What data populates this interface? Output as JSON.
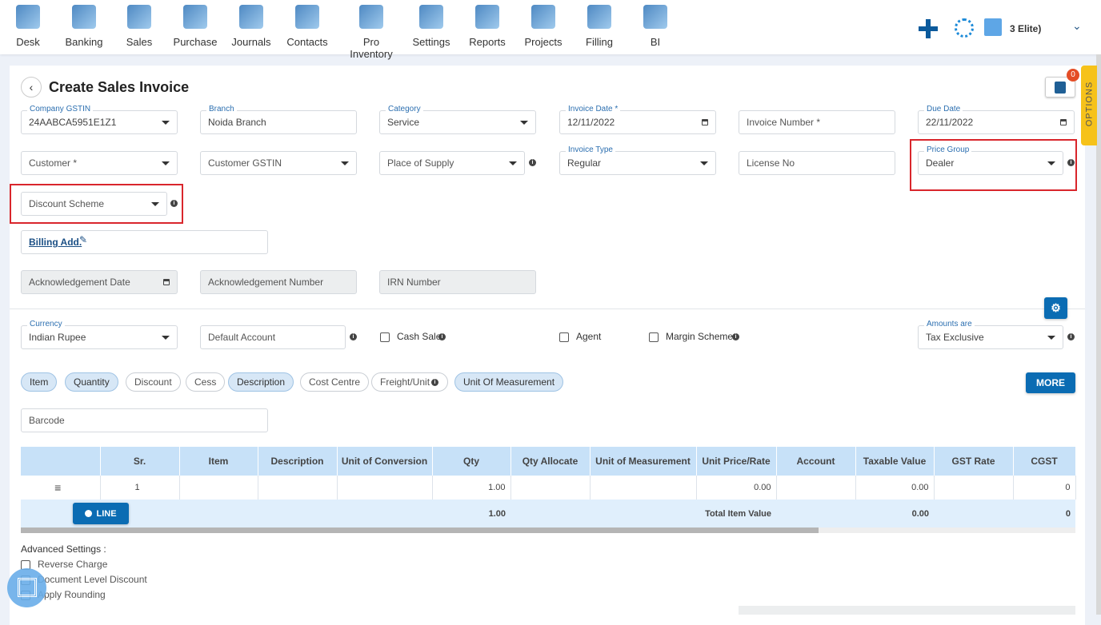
{
  "nav": {
    "items": [
      "Desk",
      "Banking",
      "Sales",
      "Purchase",
      "Journals",
      "Contacts",
      "Pro Inventory",
      "Settings",
      "Reports",
      "Projects",
      "Filling",
      "BI"
    ],
    "company": "3 Elite)",
    "icons": [
      "plus-icon",
      "gear-icon",
      "calculator-icon",
      "chevron-down-icon"
    ]
  },
  "page": {
    "title": "Create Sales Invoice",
    "badge_count": "0",
    "options_tab": "OPTIONS"
  },
  "form": {
    "company_gstin": {
      "label": "Company GSTIN",
      "value": "24AABCA5951E1Z1"
    },
    "branch": {
      "label": "Branch",
      "value": "Noida Branch"
    },
    "category": {
      "label": "Category",
      "value": "Service"
    },
    "invoice_date": {
      "label": "Invoice Date *",
      "value": "12/11/2022"
    },
    "invoice_number": {
      "placeholder": "Invoice Number *"
    },
    "due_date": {
      "label": "Due Date",
      "value": "22/11/2022"
    },
    "customer": {
      "placeholder": "Customer *"
    },
    "customer_gstin": {
      "placeholder": "Customer GSTIN"
    },
    "place_of_supply": {
      "placeholder": "Place of Supply"
    },
    "invoice_type": {
      "label": "Invoice Type",
      "value": "Regular"
    },
    "license_no": {
      "placeholder": "License No"
    },
    "price_group": {
      "label": "Price Group",
      "value": "Dealer"
    },
    "discount_scheme": {
      "placeholder": "Discount Scheme"
    },
    "billing_add": "Billing Add.",
    "ack_date": {
      "placeholder": "Acknowledgement Date"
    },
    "ack_number": {
      "placeholder": "Acknowledgement Number"
    },
    "irn_number": {
      "placeholder": "IRN Number"
    },
    "currency": {
      "label": "Currency",
      "value": "Indian Rupee"
    },
    "default_account": {
      "placeholder": "Default Account"
    },
    "cash_sale": "Cash Sale",
    "agent": "Agent",
    "margin_scheme": "Margin Scheme",
    "amounts_are": {
      "label": "Amounts are",
      "value": "Tax Exclusive"
    },
    "barcode": {
      "placeholder": "Barcode"
    }
  },
  "chips": [
    {
      "label": "Item",
      "on": true
    },
    {
      "label": "Quantity",
      "on": true
    },
    {
      "label": "Discount",
      "on": false
    },
    {
      "label": "Cess",
      "on": false
    },
    {
      "label": "Description",
      "on": true
    },
    {
      "label": "Cost Centre",
      "on": false
    },
    {
      "label": "Freight/Unit",
      "on": false
    },
    {
      "label": "Unit Of Measurement",
      "on": true
    }
  ],
  "more_label": "MORE",
  "table": {
    "headers": [
      "",
      "Sr.",
      "Item",
      "Description",
      "Unit of Conversion",
      "Qty",
      "Qty Allocate",
      "Unit of Measurement",
      "Unit Price/Rate",
      "Account",
      "Taxable Value",
      "GST Rate",
      "CGST"
    ],
    "rows": [
      [
        "",
        "1",
        "",
        "",
        "",
        "1.00",
        "",
        "",
        "0.00",
        "",
        "0.00",
        "",
        "0"
      ]
    ],
    "line_label": "LINE",
    "total_qty": "1.00",
    "total_label": "Total Item Value",
    "total_taxable": "0.00",
    "total_cgst": "0"
  },
  "advanced": {
    "title": "Advanced Settings :",
    "options": [
      "Reverse Charge",
      "Document Level Discount",
      "Apply Rounding"
    ]
  }
}
